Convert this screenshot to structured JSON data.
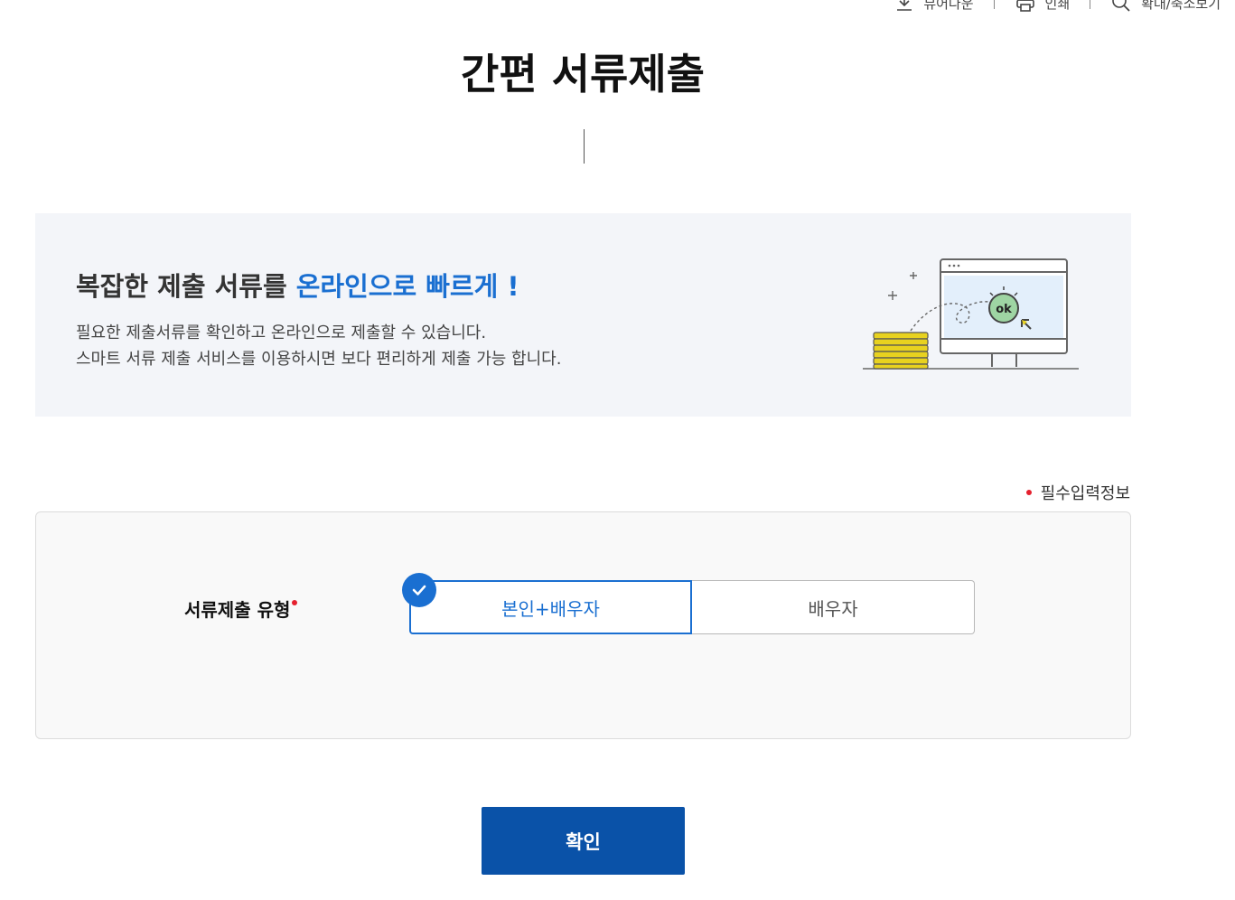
{
  "utility_bar": {
    "items": [
      {
        "label": "뷰어다운",
        "icon": "download-icon"
      },
      {
        "label": "인쇄",
        "icon": "printer-icon"
      },
      {
        "label": "확대/축소보기",
        "icon": "zoom-icon"
      }
    ]
  },
  "page": {
    "title": "간편 서류제출"
  },
  "banner": {
    "headline_prefix": "복잡한 제출 서류를 ",
    "headline_accent": "온라인으로 빠르게 !",
    "desc_line1": "필요한 제출서류를 확인하고 온라인으로 제출할 수 있습니다.",
    "desc_line2": "스마트 서류 제출 서비스를 이용하시면 보다 편리하게 제출 가능 합니다.",
    "illustration_badge": "ok",
    "illustration_icon": "monitor-coins-illustration"
  },
  "required_legend": {
    "label": "필수입력정보"
  },
  "form": {
    "field_label": "서류제출 유형",
    "options": [
      {
        "label": "본인+배우자",
        "selected": true
      },
      {
        "label": "배우자",
        "selected": false
      }
    ]
  },
  "actions": {
    "confirm_label": "확인"
  },
  "colors": {
    "accent": "#1a6fd1",
    "primary_button": "#0a52a8",
    "required": "#e5202e",
    "banner_bg": "#f3f5f9"
  }
}
